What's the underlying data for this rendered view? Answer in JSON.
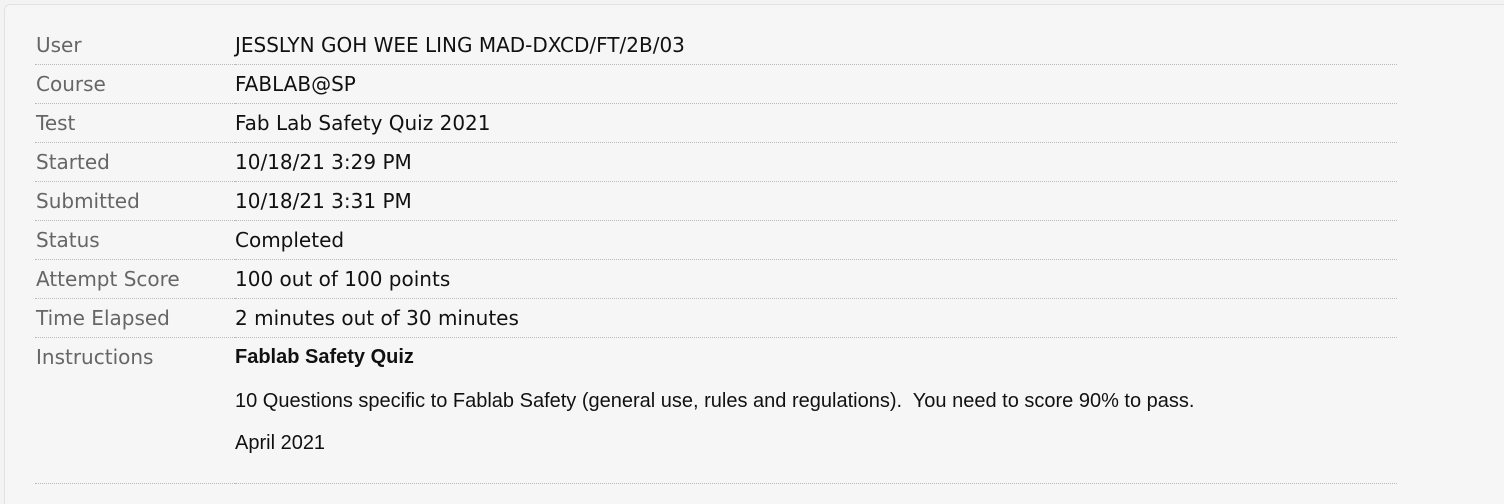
{
  "attempt_details": {
    "user": {
      "label": "User",
      "value": "JESSLYN GOH WEE LING MAD-DXCD/FT/2B/03"
    },
    "course": {
      "label": "Course",
      "value": "FABLAB@SP"
    },
    "test": {
      "label": "Test",
      "value": "Fab Lab Safety Quiz 2021"
    },
    "started": {
      "label": "Started",
      "value": "10/18/21 3:29 PM"
    },
    "submitted": {
      "label": "Submitted",
      "value": "10/18/21 3:31 PM"
    },
    "status": {
      "label": "Status",
      "value": "Completed"
    },
    "attempt_score": {
      "label": "Attempt Score",
      "value": "100 out of 100 points"
    },
    "time_elapsed": {
      "label": "Time Elapsed",
      "value": "2 minutes out of 30 minutes"
    },
    "instructions": {
      "label": "Instructions",
      "title": "Fablab Safety Quiz",
      "body": "10 Questions specific to Fablab Safety (general use, rules and regulations).  You need to score 90% to pass.",
      "date": "April 2021"
    }
  }
}
